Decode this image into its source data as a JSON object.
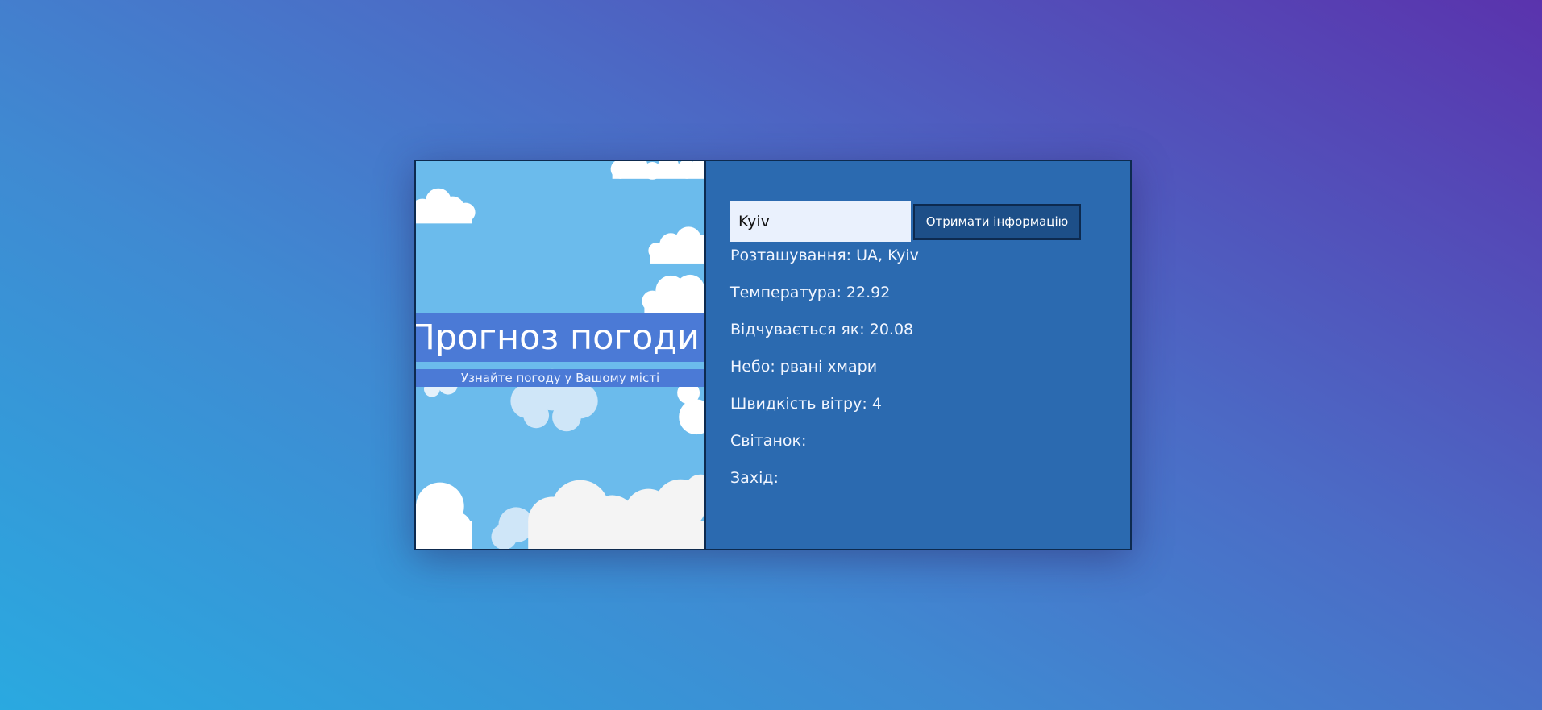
{
  "header": {
    "title": "Прогноз погоди:",
    "subtitle": "Узнайте погоду у Вашому місті"
  },
  "search": {
    "value": "Kyiv",
    "button_label": "Отримати інформацію"
  },
  "weather": {
    "items": [
      {
        "label": "Розташування:",
        "value": "UA, Kyiv"
      },
      {
        "label": "Температура:",
        "value": "22.92"
      },
      {
        "label": "Відчувається як:",
        "value": "20.08"
      },
      {
        "label": "Небо:",
        "value": "рвані хмари"
      },
      {
        "label": "Швидкість вітру:",
        "value": "4"
      },
      {
        "label": "Світанок:",
        "value": ""
      },
      {
        "label": "Захід:",
        "value": ""
      }
    ]
  },
  "colors": {
    "panel": "#2b6ab0",
    "sky": "#6bbbec",
    "band": "#4b7ad6",
    "button": "#1d4f88"
  },
  "icons": {
    "background": "clouds-image"
  }
}
